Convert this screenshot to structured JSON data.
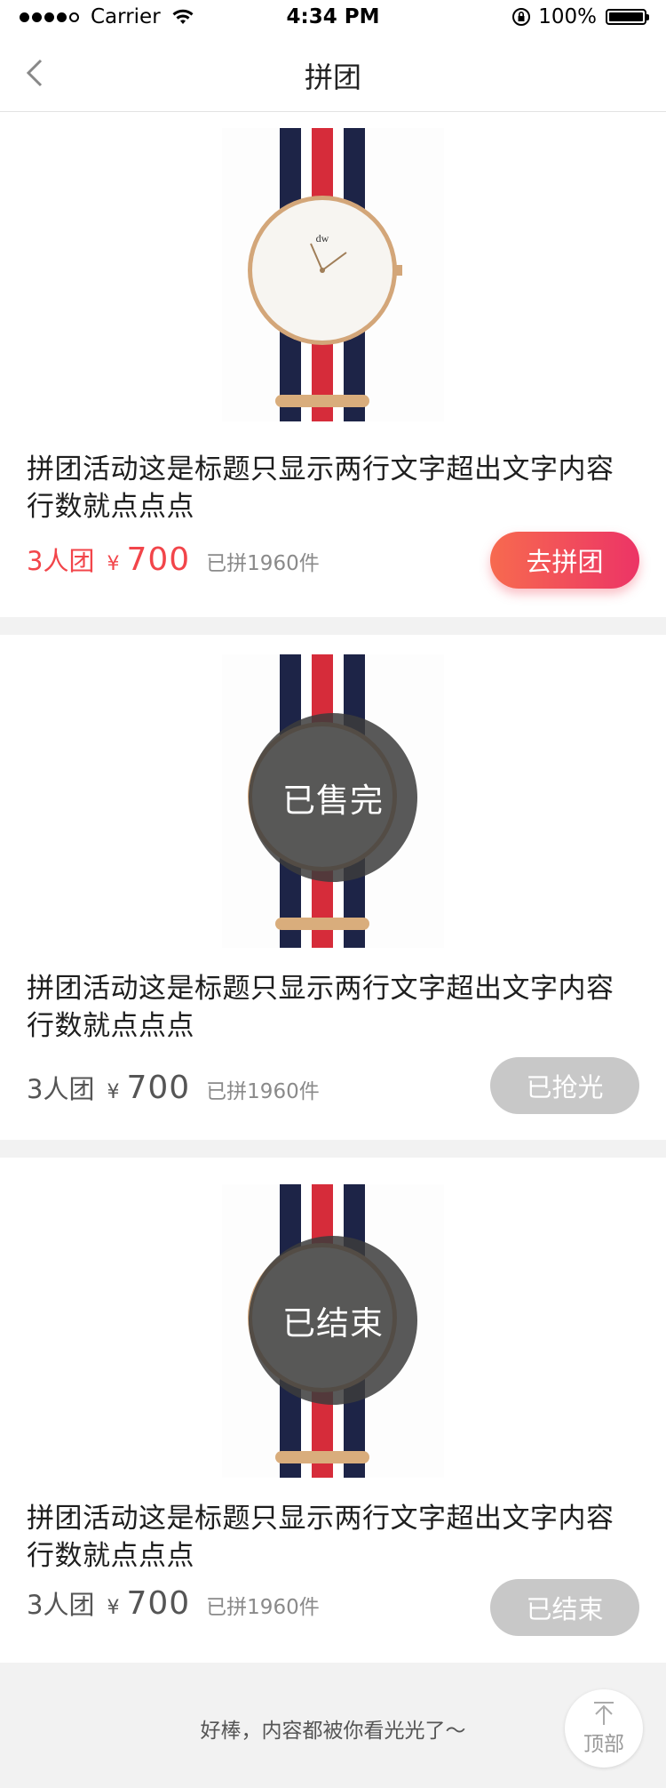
{
  "status_bar": {
    "carrier": "Carrier",
    "time": "4:34 PM",
    "battery": "100%"
  },
  "nav": {
    "title": "拼团"
  },
  "items": [
    {
      "title": "拼团活动这是标题只显示两行文字超出文字内容行数就点点点",
      "group": "3人团",
      "currency": "¥",
      "price": "700",
      "sold": "已拼1960件",
      "button": "去拼团",
      "overlay": ""
    },
    {
      "title": "拼团活动这是标题只显示两行文字超出文字内容行数就点点点",
      "group": "3人团",
      "currency": "¥",
      "price": "700",
      "sold": "已拼1960件",
      "button": "已抢光",
      "overlay": "已售完"
    },
    {
      "title": "拼团活动这是标题只显示两行文字超出文字内容行数就点点点",
      "group": "3人团",
      "currency": "¥",
      "price": "700",
      "sold": "已拼1960件",
      "button": "已结束",
      "overlay": "已结束"
    }
  ],
  "footer": {
    "message": "好棒，内容都被你看光光了～",
    "top_label": "顶部"
  },
  "colors": {
    "accent_red": "#f2454a",
    "button_gradient_start": "#f76a4f",
    "button_gradient_end": "#ec3466",
    "disabled": "#c8c8c8"
  },
  "icons": {
    "back": "chevron-left-icon",
    "top": "arrow-up-icon",
    "watch": "watch-image"
  }
}
